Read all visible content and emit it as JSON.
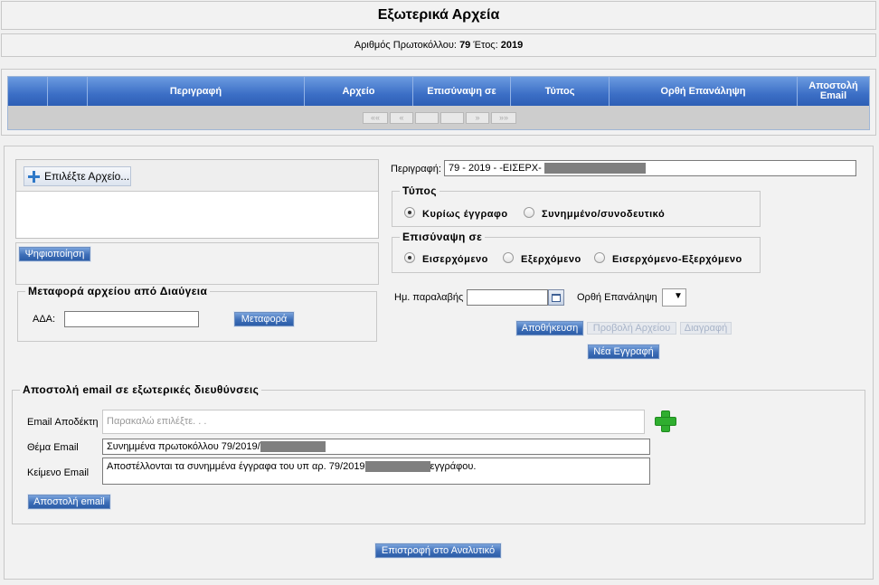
{
  "header": {
    "title": "Εξωτερικά Αρχεία"
  },
  "protocol": {
    "label": "Αριθμός Πρωτοκόλλου:",
    "number": "79",
    "year_label": "Έτος:",
    "year": "2019"
  },
  "grid": {
    "columns": [
      "Περιγραφή",
      "Αρχείο",
      "Επισύναψη σε",
      "Τύπος",
      "Ορθή Επανάληψη",
      "Αποστολή Email"
    ],
    "pager": {
      "first": "««",
      "prev": "«",
      "next": "»",
      "last": "»»"
    }
  },
  "upload": {
    "choose_label": "Επιλέξτε Αρχείο...",
    "scan_label": "Ψηφιοποίηση"
  },
  "diavgeia": {
    "legend": "Μεταφορά αρχείου από Διαύγεια",
    "ada_label": "ΑΔΑ:",
    "ada_value": "",
    "transfer_label": "Μεταφορά"
  },
  "form": {
    "description_label": "Περιγραφή:",
    "description_value": "79 - 2019 - -ΕΙΣΕΡΧ- ",
    "type_legend": "Τύπος",
    "type_options": [
      "Κυρίως έγγραφο",
      "Συνημμένο/συνοδευτικό"
    ],
    "type_selected": "Κυρίως έγγραφο",
    "attach_legend": "Επισύναψη σε",
    "attach_options": [
      "Εισερχόμενο",
      "Εξερχόμενο",
      "Εισερχόμενο-Εξερχόμενο"
    ],
    "attach_selected": "Εισερχόμενο",
    "receipt_date_label": "Ημ. παραλαβής",
    "receipt_date_value": "",
    "repeat_label": "Ορθή Επανάληψη",
    "repeat_value": "",
    "save_label": "Αποθήκευση",
    "view_label": "Προβολή Αρχείου",
    "delete_label": "Διαγραφή",
    "new_label": "Νέα Εγγραφή"
  },
  "email": {
    "legend": "Αποστολή email σε εξωτερικές διευθύνσεις",
    "recipient_label": "Email Αποδέκτη",
    "recipient_placeholder": "Παρακαλώ επιλέξτε. . .",
    "subject_label": "Θέμα Email",
    "subject_value": "Συνημμένα πρωτοκόλλου 79/2019/",
    "body_label": "Κείμενο Email",
    "body_value_start": "Αποστέλλονται τα συνημμένα έγγραφα του υπ αρ. 79/2019",
    "body_value_end": "εγγράφου.",
    "send_label": "Αποστολή email"
  },
  "footer": {
    "back_label": "Επιστροφή στο Αναλυτικό"
  }
}
